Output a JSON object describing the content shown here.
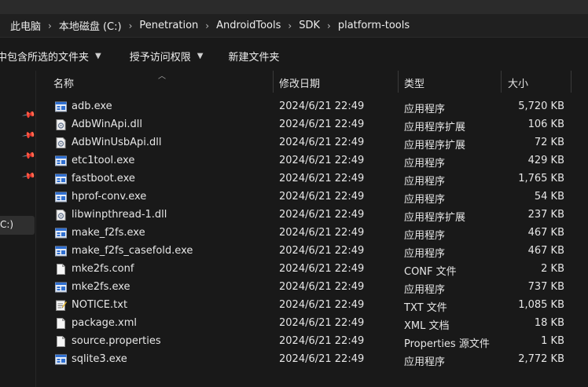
{
  "breadcrumb": [
    "此电脑",
    "本地磁盘 (C:)",
    "Penetration",
    "AndroidTools",
    "SDK",
    "platform-tools"
  ],
  "toolbar": {
    "include_in_library": "中包含所选的文件夹",
    "grant_access": "授予访问权限",
    "new_folder": "新建文件夹"
  },
  "navpane": {
    "selected_drive": "C:)"
  },
  "columns": {
    "name": "名称",
    "date": "修改日期",
    "type": "类型",
    "size": "大小"
  },
  "files": [
    {
      "name": "adb.exe",
      "date": "2024/6/21 22:49",
      "type": "应用程序",
      "size": "5,720 KB",
      "icon": "exe-icon"
    },
    {
      "name": "AdbWinApi.dll",
      "date": "2024/6/21 22:49",
      "type": "应用程序扩展",
      "size": "106 KB",
      "icon": "dll-icon"
    },
    {
      "name": "AdbWinUsbApi.dll",
      "date": "2024/6/21 22:49",
      "type": "应用程序扩展",
      "size": "72 KB",
      "icon": "dll-icon"
    },
    {
      "name": "etc1tool.exe",
      "date": "2024/6/21 22:49",
      "type": "应用程序",
      "size": "429 KB",
      "icon": "exe-icon"
    },
    {
      "name": "fastboot.exe",
      "date": "2024/6/21 22:49",
      "type": "应用程序",
      "size": "1,765 KB",
      "icon": "exe-icon"
    },
    {
      "name": "hprof-conv.exe",
      "date": "2024/6/21 22:49",
      "type": "应用程序",
      "size": "54 KB",
      "icon": "exe-icon"
    },
    {
      "name": "libwinpthread-1.dll",
      "date": "2024/6/21 22:49",
      "type": "应用程序扩展",
      "size": "237 KB",
      "icon": "dll-icon"
    },
    {
      "name": "make_f2fs.exe",
      "date": "2024/6/21 22:49",
      "type": "应用程序",
      "size": "467 KB",
      "icon": "exe-icon"
    },
    {
      "name": "make_f2fs_casefold.exe",
      "date": "2024/6/21 22:49",
      "type": "应用程序",
      "size": "467 KB",
      "icon": "exe-icon"
    },
    {
      "name": "mke2fs.conf",
      "date": "2024/6/21 22:49",
      "type": "CONF 文件",
      "size": "2 KB",
      "icon": "file-icon"
    },
    {
      "name": "mke2fs.exe",
      "date": "2024/6/21 22:49",
      "type": "应用程序",
      "size": "737 KB",
      "icon": "exe-icon"
    },
    {
      "name": "NOTICE.txt",
      "date": "2024/6/21 22:49",
      "type": "TXT 文件",
      "size": "1,085 KB",
      "icon": "txt-icon"
    },
    {
      "name": "package.xml",
      "date": "2024/6/21 22:49",
      "type": "XML 文档",
      "size": "18 KB",
      "icon": "file-icon"
    },
    {
      "name": "source.properties",
      "date": "2024/6/21 22:49",
      "type": "Properties 源文件",
      "size": "1 KB",
      "icon": "file-icon"
    },
    {
      "name": "sqlite3.exe",
      "date": "2024/6/21 22:49",
      "type": "应用程序",
      "size": "2,772 KB",
      "icon": "exe-icon"
    }
  ]
}
